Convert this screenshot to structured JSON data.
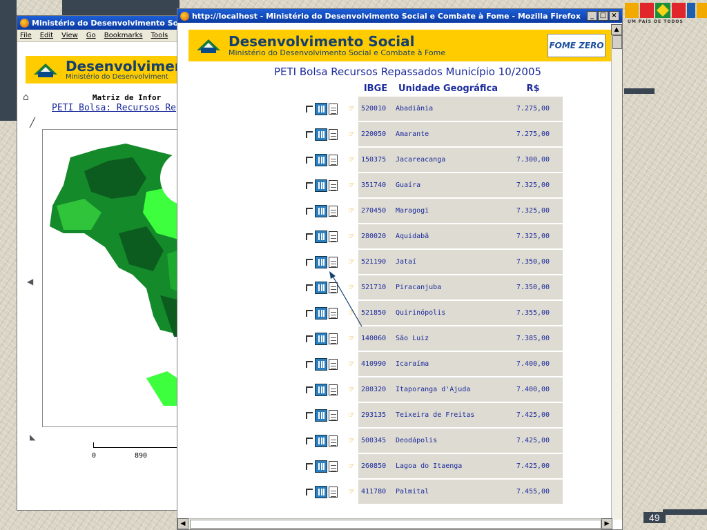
{
  "slide": {
    "page_number": "49",
    "brasil_logo": "BRASIL",
    "brasil_tagline": "UM PAÍS DE TODOS"
  },
  "back_window": {
    "title": "Ministério do Desenvolvimento Social e",
    "menu": [
      "File",
      "Edit",
      "View",
      "Go",
      "Bookmarks",
      "Tools"
    ],
    "banner_title": "Desenvolviment",
    "banner_subtitle": "Ministério do Desenvolviment",
    "matrix_label": "Matriz de Infor",
    "page_link": "PETI Bolsa: Recursos Re",
    "scale_labels": [
      "0",
      "890"
    ]
  },
  "front_window": {
    "title": "http://localhost - Ministério do Desenvolvimento Social e Combate à Fome - Mozilla Firefox",
    "banner_title": "Desenvolvimento Social",
    "banner_subtitle": "Ministério do Desenvolvimento Social e Combate à Fome",
    "fome_zero": "FOME ZERO",
    "page_title": "PETI Bolsa Recursos Repassados Município 10/2005",
    "columns": [
      "IBGE",
      "Unidade Geográfica",
      "R$"
    ],
    "rows": [
      {
        "ibge": "520010",
        "name": "Abadiânia",
        "value": "7.275,00"
      },
      {
        "ibge": "220050",
        "name": "Amarante",
        "value": "7.275,00"
      },
      {
        "ibge": "150375",
        "name": "Jacareacanga",
        "value": "7.300,00"
      },
      {
        "ibge": "351740",
        "name": "Guaíra",
        "value": "7.325,00"
      },
      {
        "ibge": "270450",
        "name": "Maragogi",
        "value": "7.325,00"
      },
      {
        "ibge": "280020",
        "name": "Aquidabã",
        "value": "7.325,00"
      },
      {
        "ibge": "521190",
        "name": "Jataí",
        "value": "7.350,00"
      },
      {
        "ibge": "521710",
        "name": "Piracanjuba",
        "value": "7.350,00"
      },
      {
        "ibge": "521850",
        "name": "Quirinópolis",
        "value": "7.355,00"
      },
      {
        "ibge": "140060",
        "name": "São Luiz",
        "value": "7.385,00"
      },
      {
        "ibge": "410990",
        "name": "Icaraíma",
        "value": "7.400,00"
      },
      {
        "ibge": "280320",
        "name": "Itaporanga d'Ajuda",
        "value": "7.400,00"
      },
      {
        "ibge": "293135",
        "name": "Teixeira de Freitas",
        "value": "7.425,00"
      },
      {
        "ibge": "500345",
        "name": "Deodápolis",
        "value": "7.425,00"
      },
      {
        "ibge": "260850",
        "name": "Lagoa do Itaenga",
        "value": "7.425,00"
      },
      {
        "ibge": "411780",
        "name": "Palmital",
        "value": "7.455,00"
      }
    ]
  },
  "colors": {
    "banner_yellow": "#ffcc00",
    "title_blue": "#1a2a9b",
    "row_gray": "#dedbd2",
    "map_green_dark": "#0b5c1e",
    "map_green_light": "#3dff3d"
  }
}
